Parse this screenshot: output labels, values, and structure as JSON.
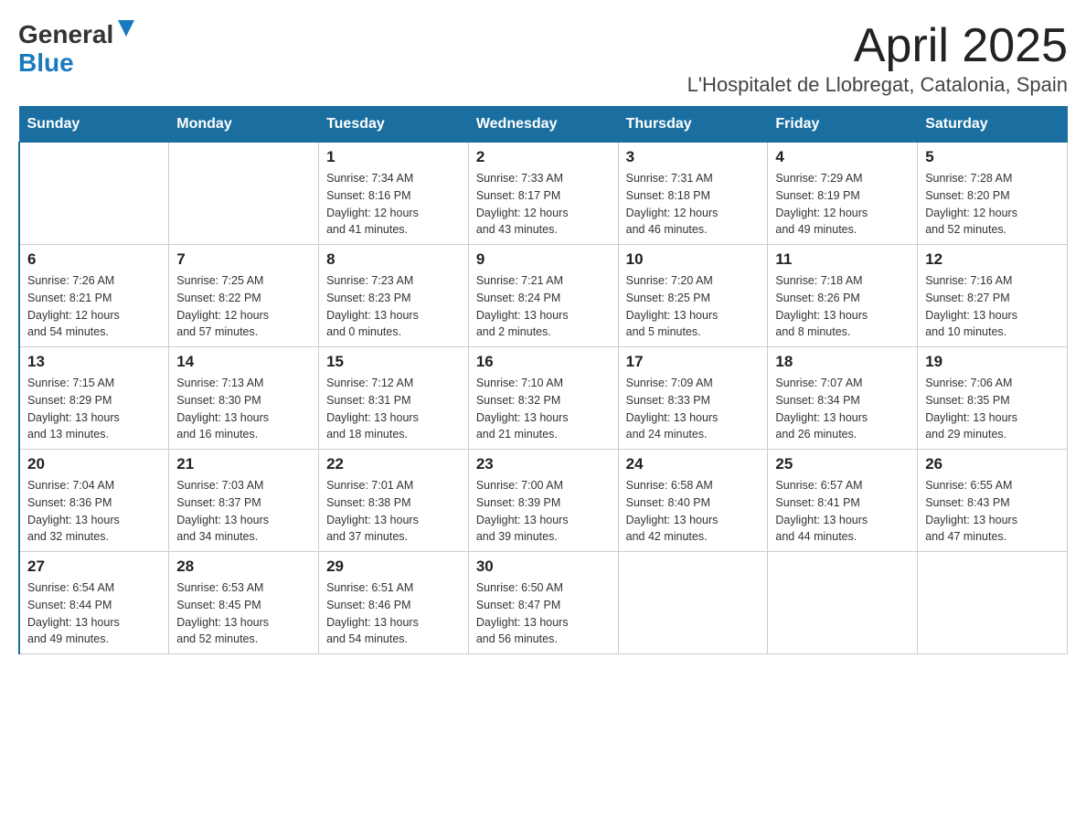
{
  "header": {
    "logo_line1": "General",
    "logo_line2": "Blue",
    "title": "April 2025",
    "subtitle": "L'Hospitalet de Llobregat, Catalonia, Spain"
  },
  "weekdays": [
    "Sunday",
    "Monday",
    "Tuesday",
    "Wednesday",
    "Thursday",
    "Friday",
    "Saturday"
  ],
  "weeks": [
    [
      {
        "day": "",
        "info": ""
      },
      {
        "day": "",
        "info": ""
      },
      {
        "day": "1",
        "info": "Sunrise: 7:34 AM\nSunset: 8:16 PM\nDaylight: 12 hours\nand 41 minutes."
      },
      {
        "day": "2",
        "info": "Sunrise: 7:33 AM\nSunset: 8:17 PM\nDaylight: 12 hours\nand 43 minutes."
      },
      {
        "day": "3",
        "info": "Sunrise: 7:31 AM\nSunset: 8:18 PM\nDaylight: 12 hours\nand 46 minutes."
      },
      {
        "day": "4",
        "info": "Sunrise: 7:29 AM\nSunset: 8:19 PM\nDaylight: 12 hours\nand 49 minutes."
      },
      {
        "day": "5",
        "info": "Sunrise: 7:28 AM\nSunset: 8:20 PM\nDaylight: 12 hours\nand 52 minutes."
      }
    ],
    [
      {
        "day": "6",
        "info": "Sunrise: 7:26 AM\nSunset: 8:21 PM\nDaylight: 12 hours\nand 54 minutes."
      },
      {
        "day": "7",
        "info": "Sunrise: 7:25 AM\nSunset: 8:22 PM\nDaylight: 12 hours\nand 57 minutes."
      },
      {
        "day": "8",
        "info": "Sunrise: 7:23 AM\nSunset: 8:23 PM\nDaylight: 13 hours\nand 0 minutes."
      },
      {
        "day": "9",
        "info": "Sunrise: 7:21 AM\nSunset: 8:24 PM\nDaylight: 13 hours\nand 2 minutes."
      },
      {
        "day": "10",
        "info": "Sunrise: 7:20 AM\nSunset: 8:25 PM\nDaylight: 13 hours\nand 5 minutes."
      },
      {
        "day": "11",
        "info": "Sunrise: 7:18 AM\nSunset: 8:26 PM\nDaylight: 13 hours\nand 8 minutes."
      },
      {
        "day": "12",
        "info": "Sunrise: 7:16 AM\nSunset: 8:27 PM\nDaylight: 13 hours\nand 10 minutes."
      }
    ],
    [
      {
        "day": "13",
        "info": "Sunrise: 7:15 AM\nSunset: 8:29 PM\nDaylight: 13 hours\nand 13 minutes."
      },
      {
        "day": "14",
        "info": "Sunrise: 7:13 AM\nSunset: 8:30 PM\nDaylight: 13 hours\nand 16 minutes."
      },
      {
        "day": "15",
        "info": "Sunrise: 7:12 AM\nSunset: 8:31 PM\nDaylight: 13 hours\nand 18 minutes."
      },
      {
        "day": "16",
        "info": "Sunrise: 7:10 AM\nSunset: 8:32 PM\nDaylight: 13 hours\nand 21 minutes."
      },
      {
        "day": "17",
        "info": "Sunrise: 7:09 AM\nSunset: 8:33 PM\nDaylight: 13 hours\nand 24 minutes."
      },
      {
        "day": "18",
        "info": "Sunrise: 7:07 AM\nSunset: 8:34 PM\nDaylight: 13 hours\nand 26 minutes."
      },
      {
        "day": "19",
        "info": "Sunrise: 7:06 AM\nSunset: 8:35 PM\nDaylight: 13 hours\nand 29 minutes."
      }
    ],
    [
      {
        "day": "20",
        "info": "Sunrise: 7:04 AM\nSunset: 8:36 PM\nDaylight: 13 hours\nand 32 minutes."
      },
      {
        "day": "21",
        "info": "Sunrise: 7:03 AM\nSunset: 8:37 PM\nDaylight: 13 hours\nand 34 minutes."
      },
      {
        "day": "22",
        "info": "Sunrise: 7:01 AM\nSunset: 8:38 PM\nDaylight: 13 hours\nand 37 minutes."
      },
      {
        "day": "23",
        "info": "Sunrise: 7:00 AM\nSunset: 8:39 PM\nDaylight: 13 hours\nand 39 minutes."
      },
      {
        "day": "24",
        "info": "Sunrise: 6:58 AM\nSunset: 8:40 PM\nDaylight: 13 hours\nand 42 minutes."
      },
      {
        "day": "25",
        "info": "Sunrise: 6:57 AM\nSunset: 8:41 PM\nDaylight: 13 hours\nand 44 minutes."
      },
      {
        "day": "26",
        "info": "Sunrise: 6:55 AM\nSunset: 8:43 PM\nDaylight: 13 hours\nand 47 minutes."
      }
    ],
    [
      {
        "day": "27",
        "info": "Sunrise: 6:54 AM\nSunset: 8:44 PM\nDaylight: 13 hours\nand 49 minutes."
      },
      {
        "day": "28",
        "info": "Sunrise: 6:53 AM\nSunset: 8:45 PM\nDaylight: 13 hours\nand 52 minutes."
      },
      {
        "day": "29",
        "info": "Sunrise: 6:51 AM\nSunset: 8:46 PM\nDaylight: 13 hours\nand 54 minutes."
      },
      {
        "day": "30",
        "info": "Sunrise: 6:50 AM\nSunset: 8:47 PM\nDaylight: 13 hours\nand 56 minutes."
      },
      {
        "day": "",
        "info": ""
      },
      {
        "day": "",
        "info": ""
      },
      {
        "day": "",
        "info": ""
      }
    ]
  ]
}
